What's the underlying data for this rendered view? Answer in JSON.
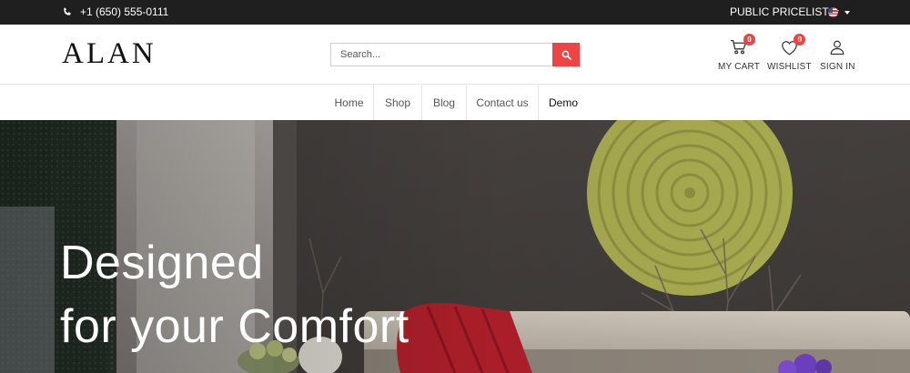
{
  "topbar": {
    "phone": "+1 (650) 555-0111",
    "pricelist_label": "PUBLIC PRICELIST",
    "language_icon": "us-flag-icon"
  },
  "header": {
    "logo": "ALAN",
    "search_placeholder": "Search...",
    "cart": {
      "label": "MY CART",
      "count": "0"
    },
    "wishlist": {
      "label": "WISHLIST",
      "count": "0"
    },
    "signin": {
      "label": "SIGN IN"
    }
  },
  "nav": {
    "items": [
      {
        "label": "Home"
      },
      {
        "label": "Shop"
      },
      {
        "label": "Blog"
      },
      {
        "label": "Contact us"
      },
      {
        "label": "Demo"
      }
    ]
  },
  "hero": {
    "line1": "Designed",
    "line2": "for your Comfort"
  },
  "colors": {
    "accent": "#ef4444",
    "topbar_bg": "#1f1f1f"
  }
}
